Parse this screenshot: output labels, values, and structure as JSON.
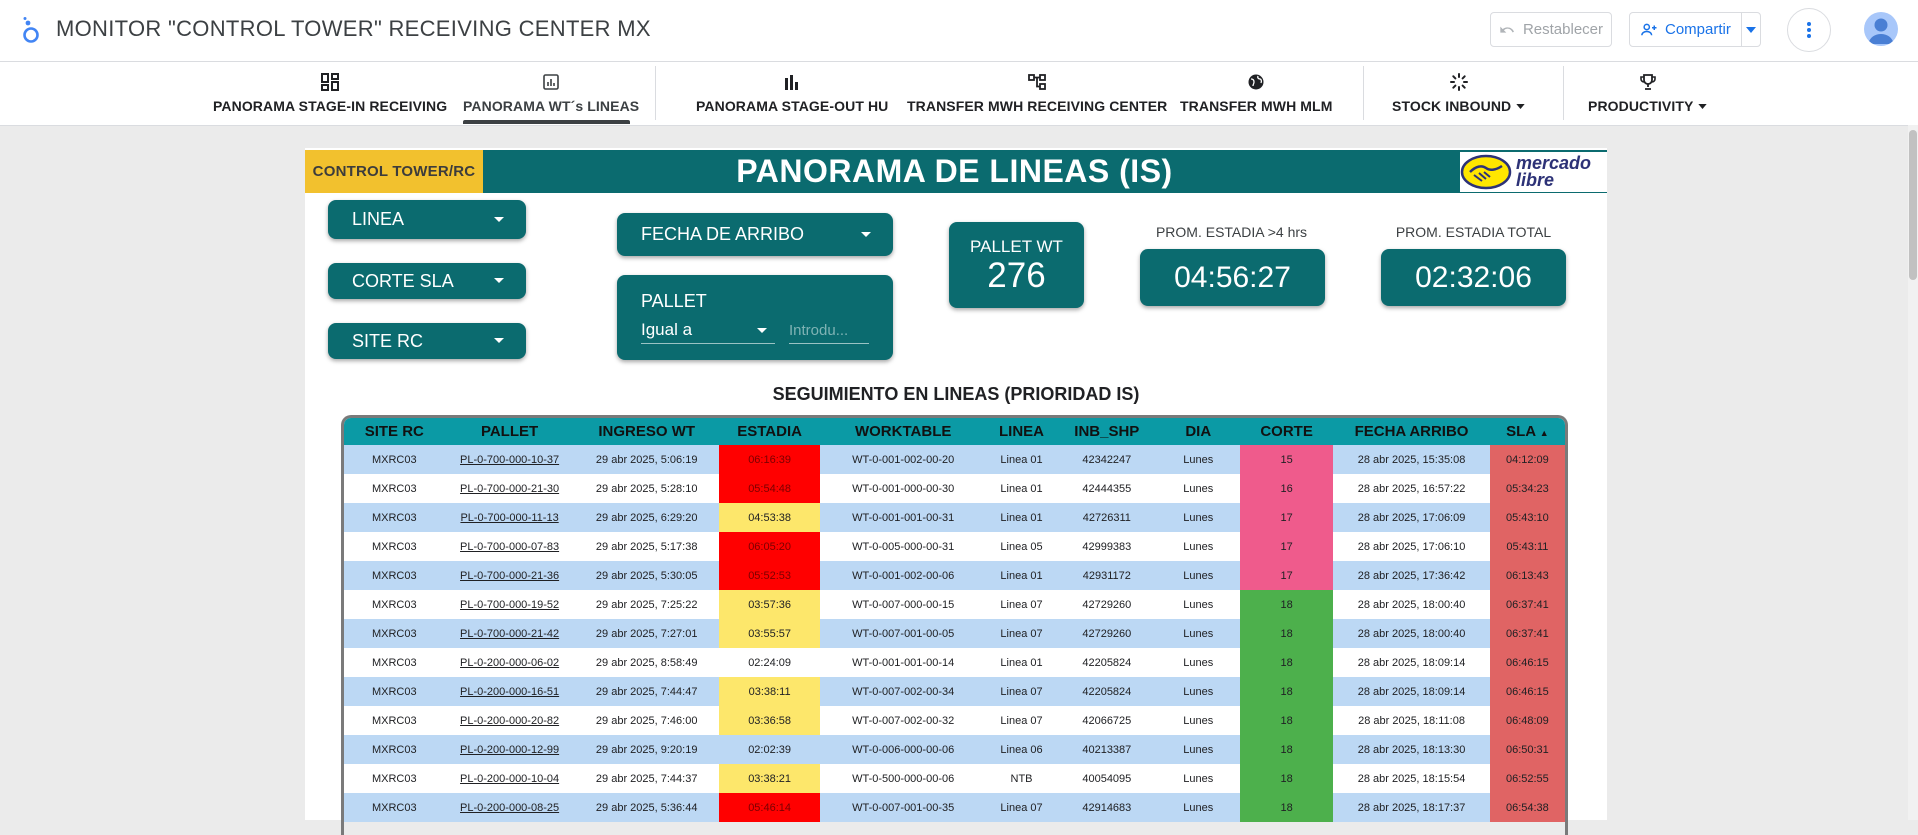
{
  "app": {
    "title": "MONITOR \"CONTROL TOWER\" RECEIVING CENTER MX"
  },
  "toolbar": {
    "reset_label": "Restablecer",
    "share_label": "Compartir"
  },
  "nav": {
    "tabs": [
      {
        "label": "PANORAMA STAGE-IN RECEIVING",
        "icon": "dashboard-icon"
      },
      {
        "label": "PANORAMA WT´s LINEAS",
        "icon": "chart-icon",
        "active": true
      },
      {
        "label": "PANORAMA STAGE-OUT HU",
        "icon": "bar-chart-icon"
      },
      {
        "label": "TRANSFER MWH RECEIVING CENTER",
        "icon": "account-tree-icon"
      },
      {
        "label": "TRANSFER MWH MLM",
        "icon": "globe-icon"
      },
      {
        "label": "STOCK INBOUND",
        "icon": "spinner-icon"
      },
      {
        "label": "PRODUCTIVITY",
        "icon": "trophy-icon"
      }
    ]
  },
  "report": {
    "ct_label": "CONTROL TOWER/RC",
    "title": "PANORAMA DE LINEAS (IS)",
    "logo_text_1": "mercado",
    "logo_text_2": "libre"
  },
  "filters": {
    "linea": "LINEA",
    "corte_sla": "CORTE SLA",
    "site_rc": "SITE RC",
    "fecha_arribo": "FECHA DE ARRIBO",
    "pallet": {
      "title": "PALLET",
      "operator": "Igual a",
      "placeholder": "Introdu..."
    }
  },
  "kpis": {
    "pallet_wt": {
      "label": "PALLET WT",
      "value": "276"
    },
    "estadia_4h": {
      "caption": "PROM. ESTADIA >4 hrs",
      "value": "04:56:27"
    },
    "estadia_total": {
      "caption": "PROM. ESTADIA TOTAL",
      "value": "02:32:06"
    }
  },
  "table": {
    "title": "SEGUIMIENTO EN LINEAS (PRIORIDAD IS)",
    "columns": [
      "SITE RC",
      "PALLET",
      "INGRESO WT",
      "ESTADIA",
      "WORKTABLE",
      "LINEA",
      "INB_SHP",
      "DIA",
      "CORTE",
      "FECHA ARRIBO",
      "SLA"
    ],
    "sort_indicator": "▲",
    "rows": [
      {
        "site": "MXRC03",
        "pallet": "PL-0-700-000-10-37",
        "ingreso": "29 abr 2025, 5:06:19",
        "estadia": "06:16:39",
        "estadia_status": "red",
        "worktable": "WT-0-001-002-00-20",
        "linea": "Linea 01",
        "inb": "42342247",
        "dia": "Lunes",
        "corte": "15",
        "corte_status": "pink",
        "arribo": "28 abr 2025, 15:35:08",
        "sla": "04:12:09"
      },
      {
        "site": "MXRC03",
        "pallet": "PL-0-700-000-21-30",
        "ingreso": "29 abr 2025, 5:28:10",
        "estadia": "05:54:48",
        "estadia_status": "red",
        "worktable": "WT-0-001-000-00-30",
        "linea": "Linea 01",
        "inb": "42444355",
        "dia": "Lunes",
        "corte": "16",
        "corte_status": "pink",
        "arribo": "28 abr 2025, 16:57:22",
        "sla": "05:34:23"
      },
      {
        "site": "MXRC03",
        "pallet": "PL-0-700-000-11-13",
        "ingreso": "29 abr 2025, 6:29:20",
        "estadia": "04:53:38",
        "estadia_status": "yellow",
        "worktable": "WT-0-001-001-00-31",
        "linea": "Linea 01",
        "inb": "42726311",
        "dia": "Lunes",
        "corte": "17",
        "corte_status": "pink",
        "arribo": "28 abr 2025, 17:06:09",
        "sla": "05:43:10"
      },
      {
        "site": "MXRC03",
        "pallet": "PL-0-700-000-07-83",
        "ingreso": "29 abr 2025, 5:17:38",
        "estadia": "06:05:20",
        "estadia_status": "red",
        "worktable": "WT-0-005-000-00-31",
        "linea": "Linea 05",
        "inb": "42999383",
        "dia": "Lunes",
        "corte": "17",
        "corte_status": "pink",
        "arribo": "28 abr 2025, 17:06:10",
        "sla": "05:43:11"
      },
      {
        "site": "MXRC03",
        "pallet": "PL-0-700-000-21-36",
        "ingreso": "29 abr 2025, 5:30:05",
        "estadia": "05:52:53",
        "estadia_status": "red",
        "worktable": "WT-0-001-002-00-06",
        "linea": "Linea 01",
        "inb": "42931172",
        "dia": "Lunes",
        "corte": "17",
        "corte_status": "pink",
        "arribo": "28 abr 2025, 17:36:42",
        "sla": "06:13:43"
      },
      {
        "site": "MXRC03",
        "pallet": "PL-0-700-000-19-52",
        "ingreso": "29 abr 2025, 7:25:22",
        "estadia": "03:57:36",
        "estadia_status": "yellow",
        "worktable": "WT-0-007-000-00-15",
        "linea": "Linea 07",
        "inb": "42729260",
        "dia": "Lunes",
        "corte": "18",
        "corte_status": "green",
        "arribo": "28 abr 2025, 18:00:40",
        "sla": "06:37:41"
      },
      {
        "site": "MXRC03",
        "pallet": "PL-0-700-000-21-42",
        "ingreso": "29 abr 2025, 7:27:01",
        "estadia": "03:55:57",
        "estadia_status": "yellow",
        "worktable": "WT-0-007-001-00-05",
        "linea": "Linea 07",
        "inb": "42729260",
        "dia": "Lunes",
        "corte": "18",
        "corte_status": "green",
        "arribo": "28 abr 2025, 18:00:40",
        "sla": "06:37:41"
      },
      {
        "site": "MXRC03",
        "pallet": "PL-0-200-000-06-02",
        "ingreso": "29 abr 2025, 8:58:49",
        "estadia": "02:24:09",
        "estadia_status": "none",
        "worktable": "WT-0-001-001-00-14",
        "linea": "Linea 01",
        "inb": "42205824",
        "dia": "Lunes",
        "corte": "18",
        "corte_status": "green",
        "arribo": "28 abr 2025, 18:09:14",
        "sla": "06:46:15"
      },
      {
        "site": "MXRC03",
        "pallet": "PL-0-200-000-16-51",
        "ingreso": "29 abr 2025, 7:44:47",
        "estadia": "03:38:11",
        "estadia_status": "yellow",
        "worktable": "WT-0-007-002-00-34",
        "linea": "Linea 07",
        "inb": "42205824",
        "dia": "Lunes",
        "corte": "18",
        "corte_status": "green",
        "arribo": "28 abr 2025, 18:09:14",
        "sla": "06:46:15"
      },
      {
        "site": "MXRC03",
        "pallet": "PL-0-200-000-20-82",
        "ingreso": "29 abr 2025, 7:46:00",
        "estadia": "03:36:58",
        "estadia_status": "yellow",
        "worktable": "WT-0-007-002-00-32",
        "linea": "Linea 07",
        "inb": "42066725",
        "dia": "Lunes",
        "corte": "18",
        "corte_status": "green",
        "arribo": "28 abr 2025, 18:11:08",
        "sla": "06:48:09"
      },
      {
        "site": "MXRC03",
        "pallet": "PL-0-200-000-12-99",
        "ingreso": "29 abr 2025, 9:20:19",
        "estadia": "02:02:39",
        "estadia_status": "none",
        "worktable": "WT-0-006-000-00-06",
        "linea": "Linea 06",
        "inb": "40213387",
        "dia": "Lunes",
        "corte": "18",
        "corte_status": "green",
        "arribo": "28 abr 2025, 18:13:30",
        "sla": "06:50:31"
      },
      {
        "site": "MXRC03",
        "pallet": "PL-0-200-000-10-04",
        "ingreso": "29 abr 2025, 7:44:37",
        "estadia": "03:38:21",
        "estadia_status": "yellow",
        "worktable": "WT-0-500-000-00-06",
        "linea": "NTB",
        "inb": "40054095",
        "dia": "Lunes",
        "corte": "18",
        "corte_status": "green",
        "arribo": "28 abr 2025, 18:15:54",
        "sla": "06:52:55"
      },
      {
        "site": "MXRC03",
        "pallet": "PL-0-200-000-08-25",
        "ingreso": "29 abr 2025, 5:36:44",
        "estadia": "05:46:14",
        "estadia_status": "red",
        "worktable": "WT-0-007-001-00-35",
        "linea": "Linea 07",
        "inb": "42914683",
        "dia": "Lunes",
        "corte": "18",
        "corte_status": "green",
        "arribo": "28 abr 2025, 18:17:37",
        "sla": "06:54:38"
      }
    ]
  },
  "colors": {
    "teal": "#0b6b6f",
    "header_teal": "#0b9aa5",
    "yellow_label": "#f2c12e",
    "row_blue": "#bcd8f4",
    "status_red": "#ff0000",
    "status_yellow": "#fde76b",
    "corte_pink": "#ef5b8c",
    "corte_green": "#4db04c",
    "sla_red": "#e06464",
    "share_blue": "#1a73e8"
  }
}
